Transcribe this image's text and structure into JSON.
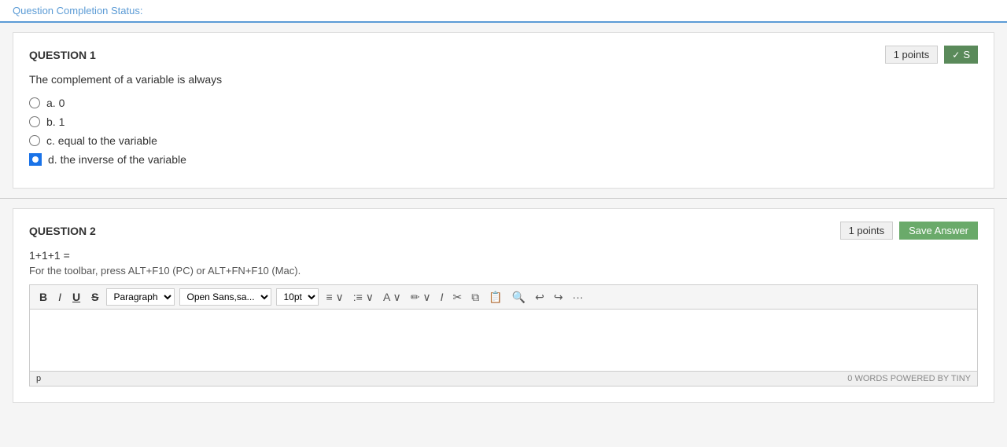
{
  "topbar": {
    "label": "Question Completion Status:"
  },
  "question1": {
    "title": "QUESTION 1",
    "points": "1 points",
    "save_label": "✓ S",
    "text": "The complement of a variable is always",
    "options": [
      {
        "id": "a",
        "label": "a. 0",
        "selected": false
      },
      {
        "id": "b",
        "label": "b. 1",
        "selected": false
      },
      {
        "id": "c",
        "label": "c. equal to the variable",
        "selected": false
      },
      {
        "id": "d",
        "label": "d. the inverse of the variable",
        "selected": true
      }
    ]
  },
  "question2": {
    "title": "QUESTION 2",
    "points": "1 points",
    "save_label": "Save Answer",
    "expression": "1+1+1 =",
    "hint": "For the toolbar, press ALT+F10 (PC) or ALT+FN+F10 (Mac).",
    "toolbar": {
      "bold": "B",
      "italic": "I",
      "underline": "U",
      "strikethrough": "S",
      "paragraph_label": "Paragraph",
      "font_label": "Open Sans,sa...",
      "size_label": "10pt"
    },
    "editor_placeholder": "p",
    "footer_words": "0 WORDS",
    "footer_powered": "POWERED BY TINY"
  }
}
